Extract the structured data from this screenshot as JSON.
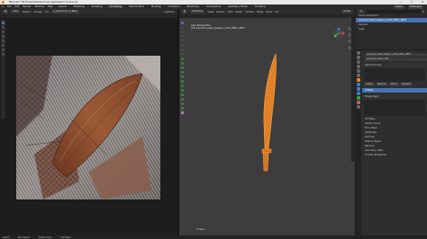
{
  "window": {
    "title": "Blender* [E:\\trash\\blade\\src\\src\\globalbrrr\\e.blend]",
    "controls": [
      "—",
      "☐",
      "✕"
    ]
  },
  "menubar": {
    "items": [
      "File",
      "Edit",
      "Render",
      "Window",
      "Help"
    ],
    "workspaces": [
      "Layout",
      "Modeling",
      "Sculpting",
      "UV Editing",
      "Texture Paint",
      "Shading",
      "Animation",
      "Rendering",
      "Compositing",
      "Geometry Nodes",
      "Scripting"
    ],
    "active_workspace": "UV Editing",
    "scene": "Scene",
    "view_layer": "ViewLayer"
  },
  "uv_editor": {
    "header": {
      "mode": "View",
      "select": "Select",
      "image": "Image",
      "uv": "UV",
      "image_name": "1_pyramid_01_lt_Base",
      "options": "Options"
    },
    "tool_icons": [
      "cursor",
      "grab",
      "rotate",
      "scale",
      "rip",
      "grab-brush",
      "relax",
      "pinch"
    ]
  },
  "viewport": {
    "header": {
      "mode": "Edit Mode",
      "view": "View",
      "select": "Select",
      "add": "Add",
      "mesh": "Mesh",
      "vertex": "Vertex",
      "edge": "Edge",
      "face": "Face",
      "uv": "UV",
      "transform": "Global"
    },
    "overlay_line1": "User Perspective",
    "overlay_line2": "(10) pyramid_head_weapon_knife_0801_0807",
    "axis_labels": [
      "X",
      "Y",
      "Z"
    ],
    "status_chip": "Collision"
  },
  "outliner": {
    "search_placeholder": "",
    "rows": [
      {
        "label": "Scene Collection",
        "selected": false
      },
      {
        "label": "pyramid_head_weapon_knife_0801_0807",
        "selected": true
      },
      {
        "label": "Camera",
        "selected": false
      },
      {
        "label": "Light",
        "selected": false
      }
    ]
  },
  "properties": {
    "object_name": "pyramid_head_weapon_knife_0801_0807",
    "mesh_name": "pyramid_head_knife",
    "sections_top": [
      "Vertex Groups",
      "Shape Keys"
    ],
    "uv_maps_label": "UV Maps",
    "uv_map_item": "UVMap",
    "buttons": [
      "Assign",
      "Remove",
      "Select",
      "Deselect"
    ],
    "active_row": "UVMap",
    "sections": [
      "Normals",
      "Texture Space",
      "Remesh",
      "Geometry Data",
      "Custom Properties"
    ],
    "lower_sections": [
      "UV Maps",
      "Vertex Colors",
      "Face Maps",
      "Attributes"
    ]
  },
  "statusbar": {
    "items": [
      "Select",
      "Box Select",
      "Rotate View",
      "Call Menu"
    ]
  },
  "colors": {
    "accent": "#4772b3",
    "mesh_orange": "#e8841f",
    "background": "#3d3d3d"
  }
}
